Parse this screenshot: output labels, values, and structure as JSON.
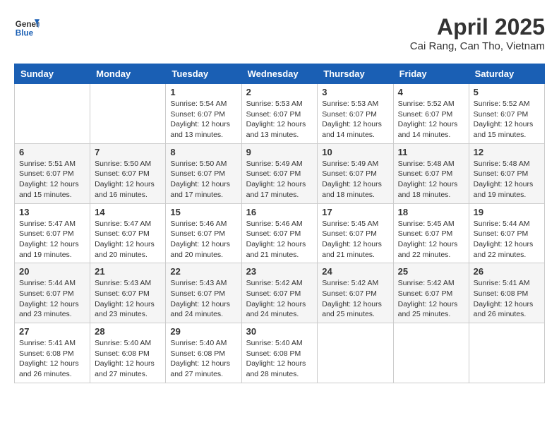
{
  "header": {
    "logo_line1": "General",
    "logo_line2": "Blue",
    "title": "April 2025",
    "subtitle": "Cai Rang, Can Tho, Vietnam"
  },
  "days_of_week": [
    "Sunday",
    "Monday",
    "Tuesday",
    "Wednesday",
    "Thursday",
    "Friday",
    "Saturday"
  ],
  "weeks": [
    [
      {
        "day": "",
        "info": ""
      },
      {
        "day": "",
        "info": ""
      },
      {
        "day": "1",
        "info": "Sunrise: 5:54 AM\nSunset: 6:07 PM\nDaylight: 12 hours\nand 13 minutes."
      },
      {
        "day": "2",
        "info": "Sunrise: 5:53 AM\nSunset: 6:07 PM\nDaylight: 12 hours\nand 13 minutes."
      },
      {
        "day": "3",
        "info": "Sunrise: 5:53 AM\nSunset: 6:07 PM\nDaylight: 12 hours\nand 14 minutes."
      },
      {
        "day": "4",
        "info": "Sunrise: 5:52 AM\nSunset: 6:07 PM\nDaylight: 12 hours\nand 14 minutes."
      },
      {
        "day": "5",
        "info": "Sunrise: 5:52 AM\nSunset: 6:07 PM\nDaylight: 12 hours\nand 15 minutes."
      }
    ],
    [
      {
        "day": "6",
        "info": "Sunrise: 5:51 AM\nSunset: 6:07 PM\nDaylight: 12 hours\nand 15 minutes."
      },
      {
        "day": "7",
        "info": "Sunrise: 5:50 AM\nSunset: 6:07 PM\nDaylight: 12 hours\nand 16 minutes."
      },
      {
        "day": "8",
        "info": "Sunrise: 5:50 AM\nSunset: 6:07 PM\nDaylight: 12 hours\nand 17 minutes."
      },
      {
        "day": "9",
        "info": "Sunrise: 5:49 AM\nSunset: 6:07 PM\nDaylight: 12 hours\nand 17 minutes."
      },
      {
        "day": "10",
        "info": "Sunrise: 5:49 AM\nSunset: 6:07 PM\nDaylight: 12 hours\nand 18 minutes."
      },
      {
        "day": "11",
        "info": "Sunrise: 5:48 AM\nSunset: 6:07 PM\nDaylight: 12 hours\nand 18 minutes."
      },
      {
        "day": "12",
        "info": "Sunrise: 5:48 AM\nSunset: 6:07 PM\nDaylight: 12 hours\nand 19 minutes."
      }
    ],
    [
      {
        "day": "13",
        "info": "Sunrise: 5:47 AM\nSunset: 6:07 PM\nDaylight: 12 hours\nand 19 minutes."
      },
      {
        "day": "14",
        "info": "Sunrise: 5:47 AM\nSunset: 6:07 PM\nDaylight: 12 hours\nand 20 minutes."
      },
      {
        "day": "15",
        "info": "Sunrise: 5:46 AM\nSunset: 6:07 PM\nDaylight: 12 hours\nand 20 minutes."
      },
      {
        "day": "16",
        "info": "Sunrise: 5:46 AM\nSunset: 6:07 PM\nDaylight: 12 hours\nand 21 minutes."
      },
      {
        "day": "17",
        "info": "Sunrise: 5:45 AM\nSunset: 6:07 PM\nDaylight: 12 hours\nand 21 minutes."
      },
      {
        "day": "18",
        "info": "Sunrise: 5:45 AM\nSunset: 6:07 PM\nDaylight: 12 hours\nand 22 minutes."
      },
      {
        "day": "19",
        "info": "Sunrise: 5:44 AM\nSunset: 6:07 PM\nDaylight: 12 hours\nand 22 minutes."
      }
    ],
    [
      {
        "day": "20",
        "info": "Sunrise: 5:44 AM\nSunset: 6:07 PM\nDaylight: 12 hours\nand 23 minutes."
      },
      {
        "day": "21",
        "info": "Sunrise: 5:43 AM\nSunset: 6:07 PM\nDaylight: 12 hours\nand 23 minutes."
      },
      {
        "day": "22",
        "info": "Sunrise: 5:43 AM\nSunset: 6:07 PM\nDaylight: 12 hours\nand 24 minutes."
      },
      {
        "day": "23",
        "info": "Sunrise: 5:42 AM\nSunset: 6:07 PM\nDaylight: 12 hours\nand 24 minutes."
      },
      {
        "day": "24",
        "info": "Sunrise: 5:42 AM\nSunset: 6:07 PM\nDaylight: 12 hours\nand 25 minutes."
      },
      {
        "day": "25",
        "info": "Sunrise: 5:42 AM\nSunset: 6:07 PM\nDaylight: 12 hours\nand 25 minutes."
      },
      {
        "day": "26",
        "info": "Sunrise: 5:41 AM\nSunset: 6:08 PM\nDaylight: 12 hours\nand 26 minutes."
      }
    ],
    [
      {
        "day": "27",
        "info": "Sunrise: 5:41 AM\nSunset: 6:08 PM\nDaylight: 12 hours\nand 26 minutes."
      },
      {
        "day": "28",
        "info": "Sunrise: 5:40 AM\nSunset: 6:08 PM\nDaylight: 12 hours\nand 27 minutes."
      },
      {
        "day": "29",
        "info": "Sunrise: 5:40 AM\nSunset: 6:08 PM\nDaylight: 12 hours\nand 27 minutes."
      },
      {
        "day": "30",
        "info": "Sunrise: 5:40 AM\nSunset: 6:08 PM\nDaylight: 12 hours\nand 28 minutes."
      },
      {
        "day": "",
        "info": ""
      },
      {
        "day": "",
        "info": ""
      },
      {
        "day": "",
        "info": ""
      }
    ]
  ]
}
